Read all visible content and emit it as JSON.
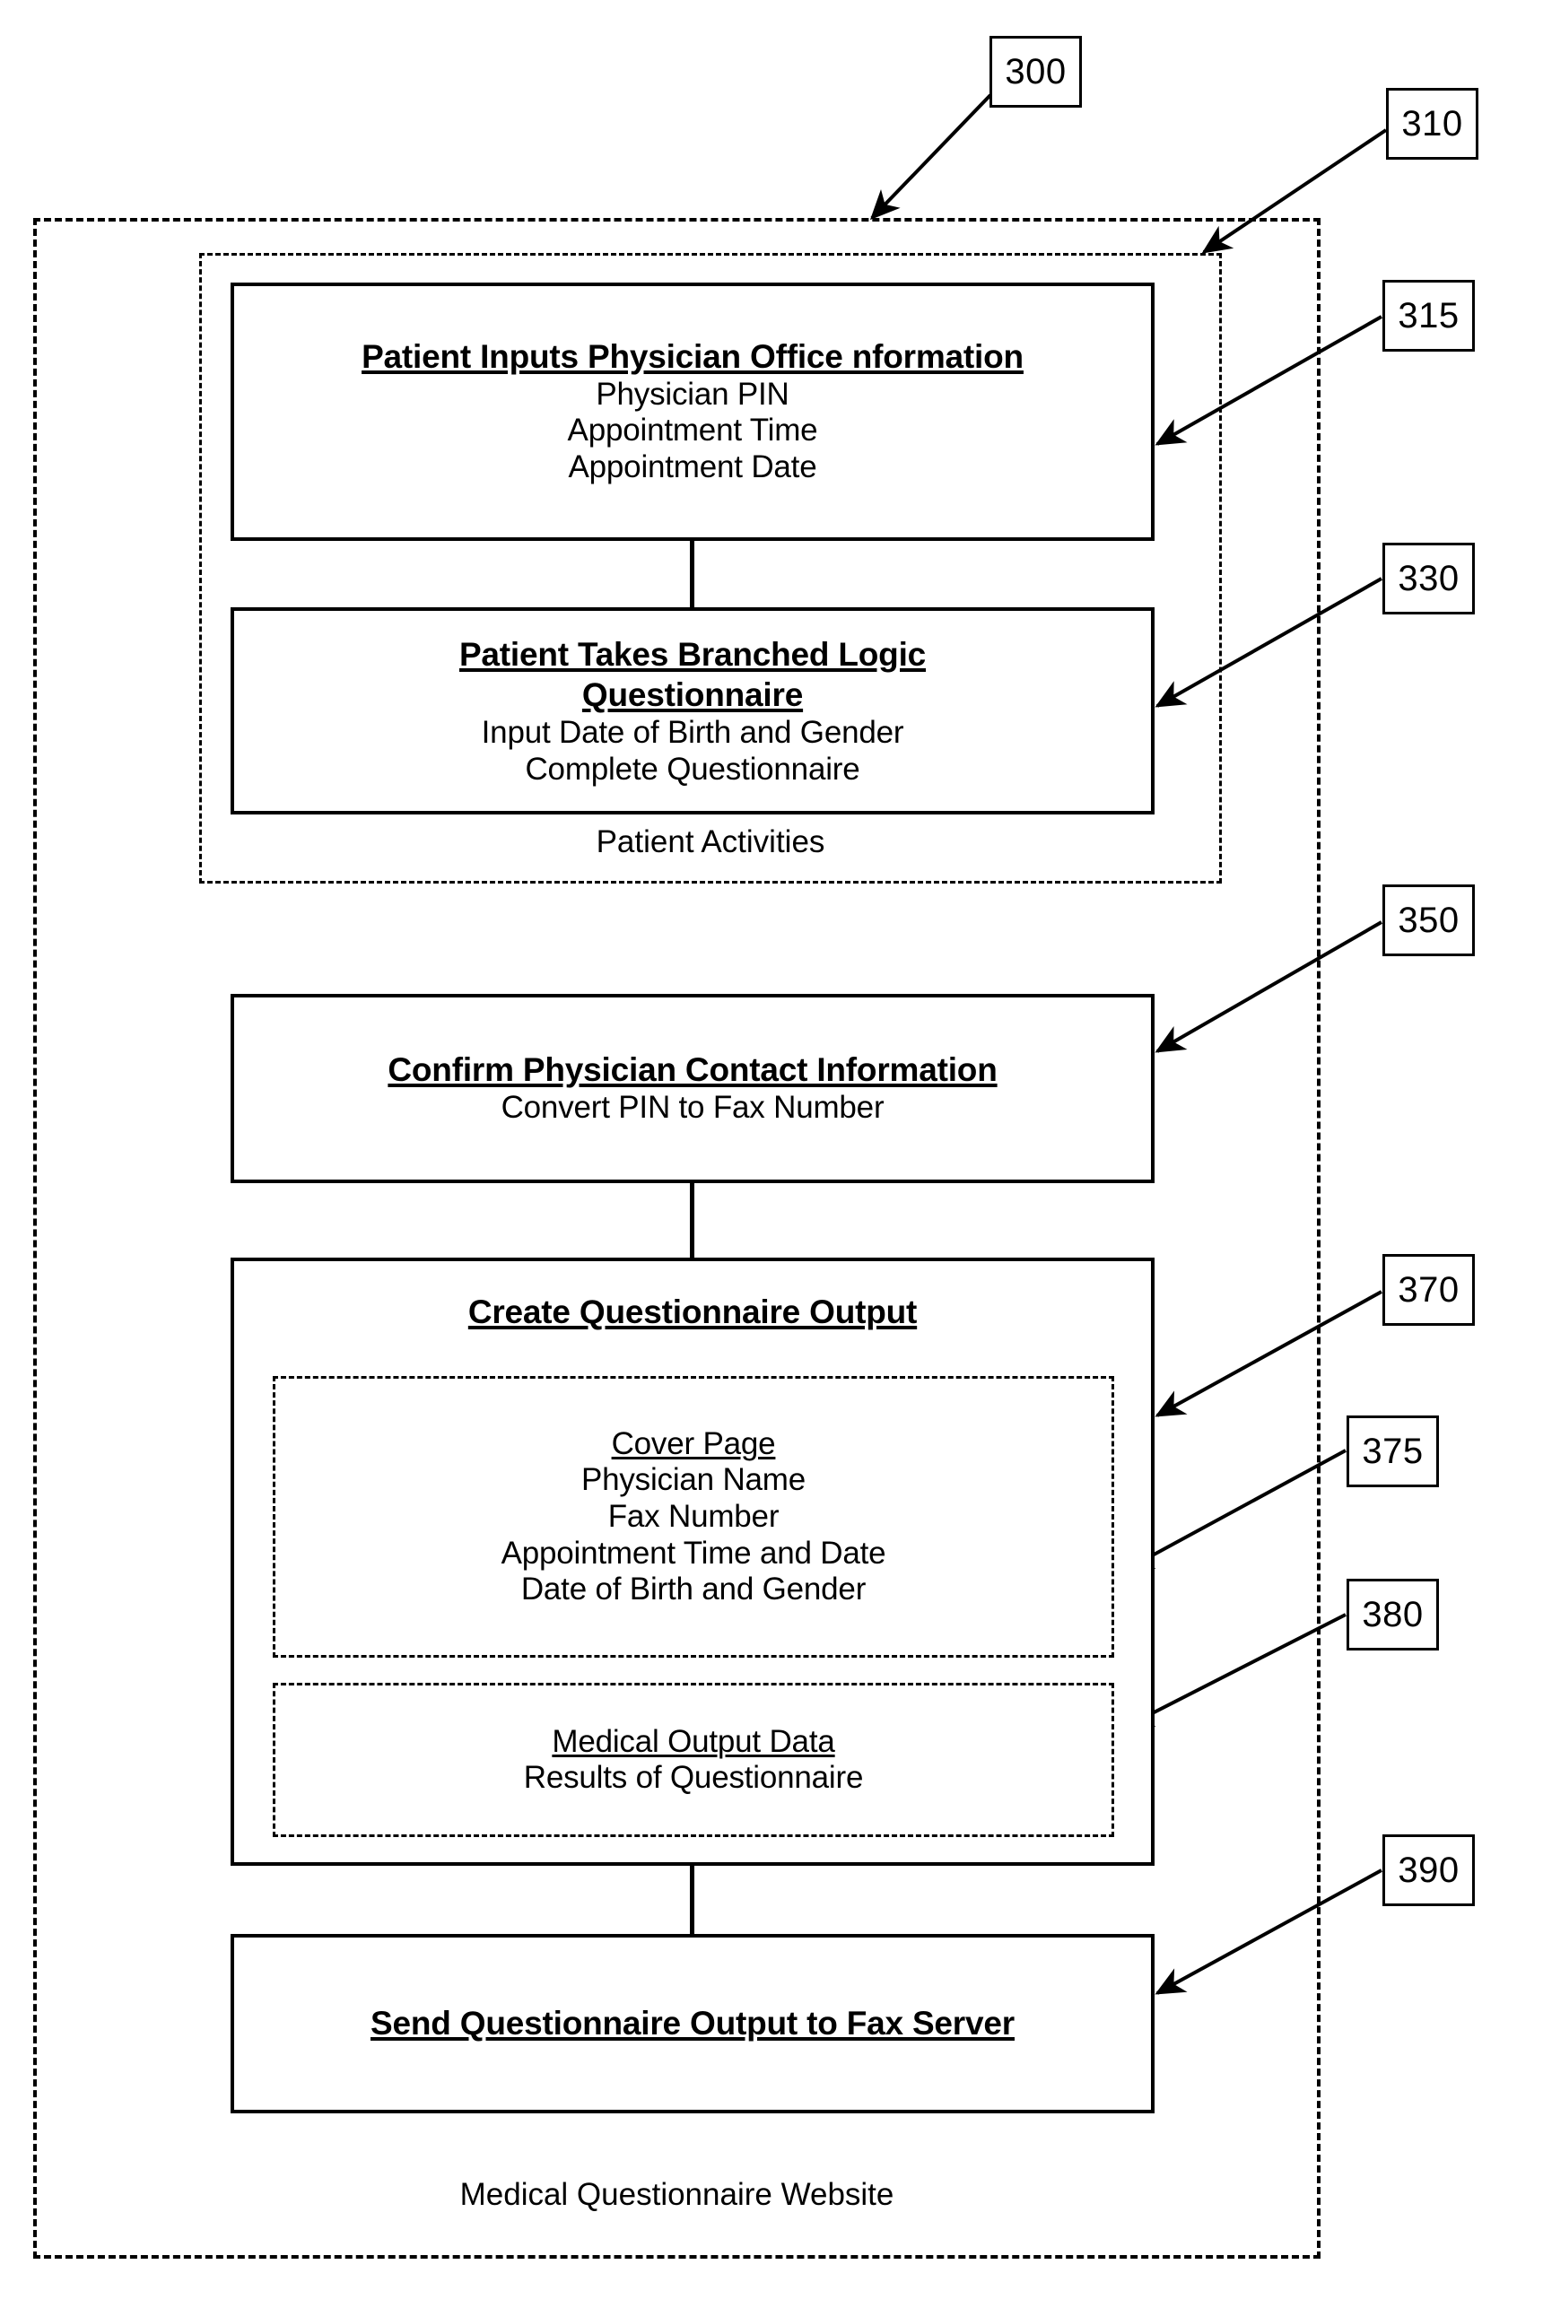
{
  "figure": {
    "outer_container": {
      "caption": "Medical Questionnaire Website",
      "ref": "300"
    },
    "patient_container": {
      "caption": "Patient Activities",
      "ref": "310"
    }
  },
  "boxes": {
    "patient_inputs": {
      "ref": "315",
      "title": "Patient Inputs Physician Office nformation",
      "lines": [
        "Physician PIN",
        "Appointment Time",
        "Appointment Date"
      ]
    },
    "branched_logic": {
      "ref": "330",
      "title_line1": "Patient Takes Branched Logic",
      "title_line2": "Questionnaire",
      "lines": [
        "Input Date of Birth and Gender",
        "Complete Questionnaire"
      ]
    },
    "confirm_contact": {
      "ref": "350",
      "title": "Confirm Physician Contact Information",
      "lines": [
        "Convert PIN to Fax Number"
      ]
    },
    "create_output": {
      "ref": "370",
      "title": "Create Questionnaire Output",
      "cover_page": {
        "ref": "375",
        "title": "Cover Page",
        "lines": [
          "Physician Name",
          "Fax Number",
          "Appointment Time and Date",
          "Date of Birth and Gender"
        ]
      },
      "medical_output": {
        "ref": "380",
        "title": "Medical Output Data",
        "lines": [
          "Results of Questionnaire"
        ]
      }
    },
    "send_output": {
      "ref": "390",
      "title": "Send Questionnaire Output to Fax Server"
    }
  },
  "refs": {
    "r300": "300",
    "r310": "310",
    "r315": "315",
    "r330": "330",
    "r350": "350",
    "r370": "370",
    "r375": "375",
    "r380": "380",
    "r390": "390"
  },
  "colors": {
    "ink": "#000000",
    "paper": "#ffffff"
  }
}
